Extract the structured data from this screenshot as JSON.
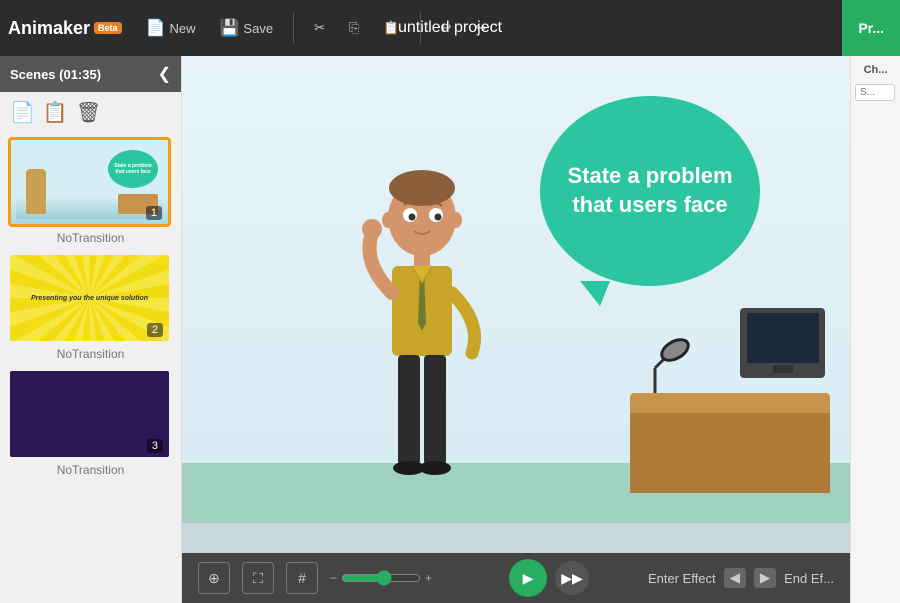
{
  "app": {
    "name": "Animaker",
    "beta_label": "Beta"
  },
  "toolbar": {
    "new_label": "New",
    "save_label": "Save",
    "undo_icon": "↩",
    "redo_icon": "↪",
    "project_title": "untitled project",
    "preview_label": "Pr..."
  },
  "scenes_panel": {
    "title": "Scenes (01:35)",
    "collapse_icon": "❮",
    "actions": [
      "new_scene",
      "duplicate_scene",
      "delete_scene"
    ],
    "scenes": [
      {
        "id": 1,
        "number": "1",
        "transition": "NoTransition",
        "active": true
      },
      {
        "id": 2,
        "number": "2",
        "transition": "NoTransition",
        "active": false,
        "label": "Presenting you the unique solution"
      },
      {
        "id": 3,
        "number": "3",
        "transition": "NoTransition",
        "active": false
      }
    ]
  },
  "canvas": {
    "speech_bubble_text": "State a problem that users face"
  },
  "bottom_toolbar": {
    "fit_icon": "⊕",
    "fullscreen_icon": "⛶",
    "grid_icon": "⊞",
    "play_label": "▶",
    "forward_label": "▶",
    "enter_effect_label": "Enter Effect",
    "end_effect_label": "End Ef..."
  },
  "right_panel": {
    "header": "Ch...",
    "search_placeholder": "S..."
  },
  "no_transition_label": "No Transition"
}
